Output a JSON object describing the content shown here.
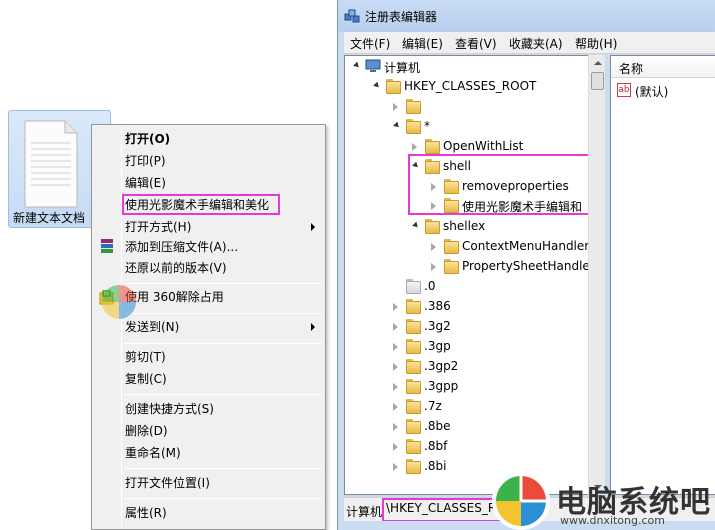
{
  "desktop": {
    "file_label": "新建文本文档"
  },
  "context_menu": {
    "items": [
      {
        "label": "打开(O)",
        "bold": true
      },
      {
        "label": "打印(P)"
      },
      {
        "label": "编辑(E)"
      },
      {
        "label": "使用光影魔术手编辑和美化"
      },
      {
        "label": "打开方式(H)",
        "submenu": true
      },
      {
        "label": "添加到压缩文件(A)..."
      },
      {
        "label": "还原以前的版本(V)"
      },
      {
        "label": "使用 360解除占用"
      },
      {
        "label": "发送到(N)",
        "submenu": true
      },
      {
        "label": "剪切(T)"
      },
      {
        "label": "复制(C)"
      },
      {
        "label": "创建快捷方式(S)"
      },
      {
        "label": "删除(D)"
      },
      {
        "label": "重命名(M)"
      },
      {
        "label": "打开文件位置(I)"
      },
      {
        "label": "属性(R)"
      }
    ]
  },
  "regedit": {
    "title": "注册表编辑器",
    "menu": [
      "文件(F)",
      "编辑(E)",
      "查看(V)",
      "收藏夹(A)",
      "帮助(H)"
    ],
    "tree": [
      {
        "label": "计算机"
      },
      {
        "label": "HKEY_CLASSES_ROOT"
      },
      {
        "label": ""
      },
      {
        "label": "*"
      },
      {
        "label": "OpenWithList"
      },
      {
        "label": "shell"
      },
      {
        "label": "removeproperties"
      },
      {
        "label": "使用光影魔术手编辑和"
      },
      {
        "label": "shellex"
      },
      {
        "label": "ContextMenuHandler"
      },
      {
        "label": "PropertySheetHandle"
      },
      {
        "label": ".0"
      },
      {
        "label": ".386"
      },
      {
        "label": ".3g2"
      },
      {
        "label": ".3gp"
      },
      {
        "label": ".3gp2"
      },
      {
        "label": ".3gpp"
      },
      {
        "label": ".7z"
      },
      {
        "label": ".8be"
      },
      {
        "label": ".8bf"
      },
      {
        "label": ".8bi"
      }
    ],
    "column_header": "名称",
    "default_value": "(默认)",
    "value_icon_text": "ab",
    "status_label": "计算机",
    "status_path": "\\HKEY_CLASSES_ROO"
  },
  "watermark": {
    "title": "电脑系统吧",
    "url": "www.dnxitong.com"
  },
  "colors": {
    "highlight_border": "#e63ad8",
    "window_frame": "#c9dcf2",
    "menu_bg": "#f0f0f0"
  }
}
